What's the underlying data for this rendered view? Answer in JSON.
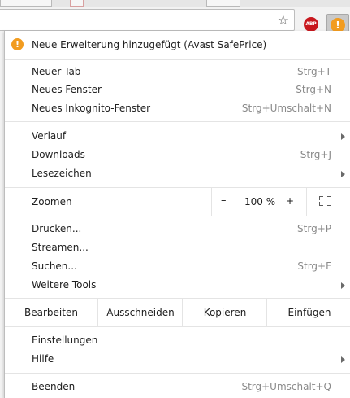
{
  "toolbar": {
    "bookmark_icon": "star-icon",
    "extensions": [
      {
        "name": "abp-icon",
        "text": "ABP",
        "color": "#c8181e"
      },
      {
        "name": "avast-warning-icon",
        "text": "!",
        "color": "#f29c1f"
      }
    ]
  },
  "menu": {
    "notice": {
      "icon": "!",
      "label": "Neue Erweiterung hinzugefügt (Avast SafePrice)"
    },
    "group1": [
      {
        "label": "Neuer Tab",
        "shortcut": "Strg+T"
      },
      {
        "label": "Neues Fenster",
        "shortcut": "Strg+N"
      },
      {
        "label": "Neues Inkognito-Fenster",
        "shortcut": "Strg+Umschalt+N"
      }
    ],
    "group2": [
      {
        "label": "Verlauf",
        "shortcut": ""
      },
      {
        "label": "Downloads",
        "shortcut": "Strg+J"
      },
      {
        "label": "Lesezeichen",
        "shortcut": ""
      }
    ],
    "zoom": {
      "label": "Zoomen",
      "minus": "–",
      "value": "100 %",
      "plus": "+"
    },
    "group3": [
      {
        "label": "Drucken...",
        "shortcut": "Strg+P"
      },
      {
        "label": "Streamen...",
        "shortcut": ""
      },
      {
        "label": "Suchen...",
        "shortcut": "Strg+F"
      },
      {
        "label": "Weitere Tools",
        "shortcut": ""
      }
    ],
    "edit": {
      "label": "Bearbeiten",
      "cut": "Ausschneiden",
      "copy": "Kopieren",
      "paste": "Einfügen"
    },
    "group4": [
      {
        "label": "Einstellungen",
        "shortcut": ""
      },
      {
        "label": "Hilfe",
        "shortcut": ""
      }
    ],
    "quit": {
      "label": "Beenden",
      "shortcut": "Strg+Umschalt+Q"
    }
  },
  "colors": {
    "accent": "#f29c1f",
    "abp": "#c8181e",
    "shortcut_text": "#8a8a8a",
    "separator": "#e4e4e4"
  }
}
